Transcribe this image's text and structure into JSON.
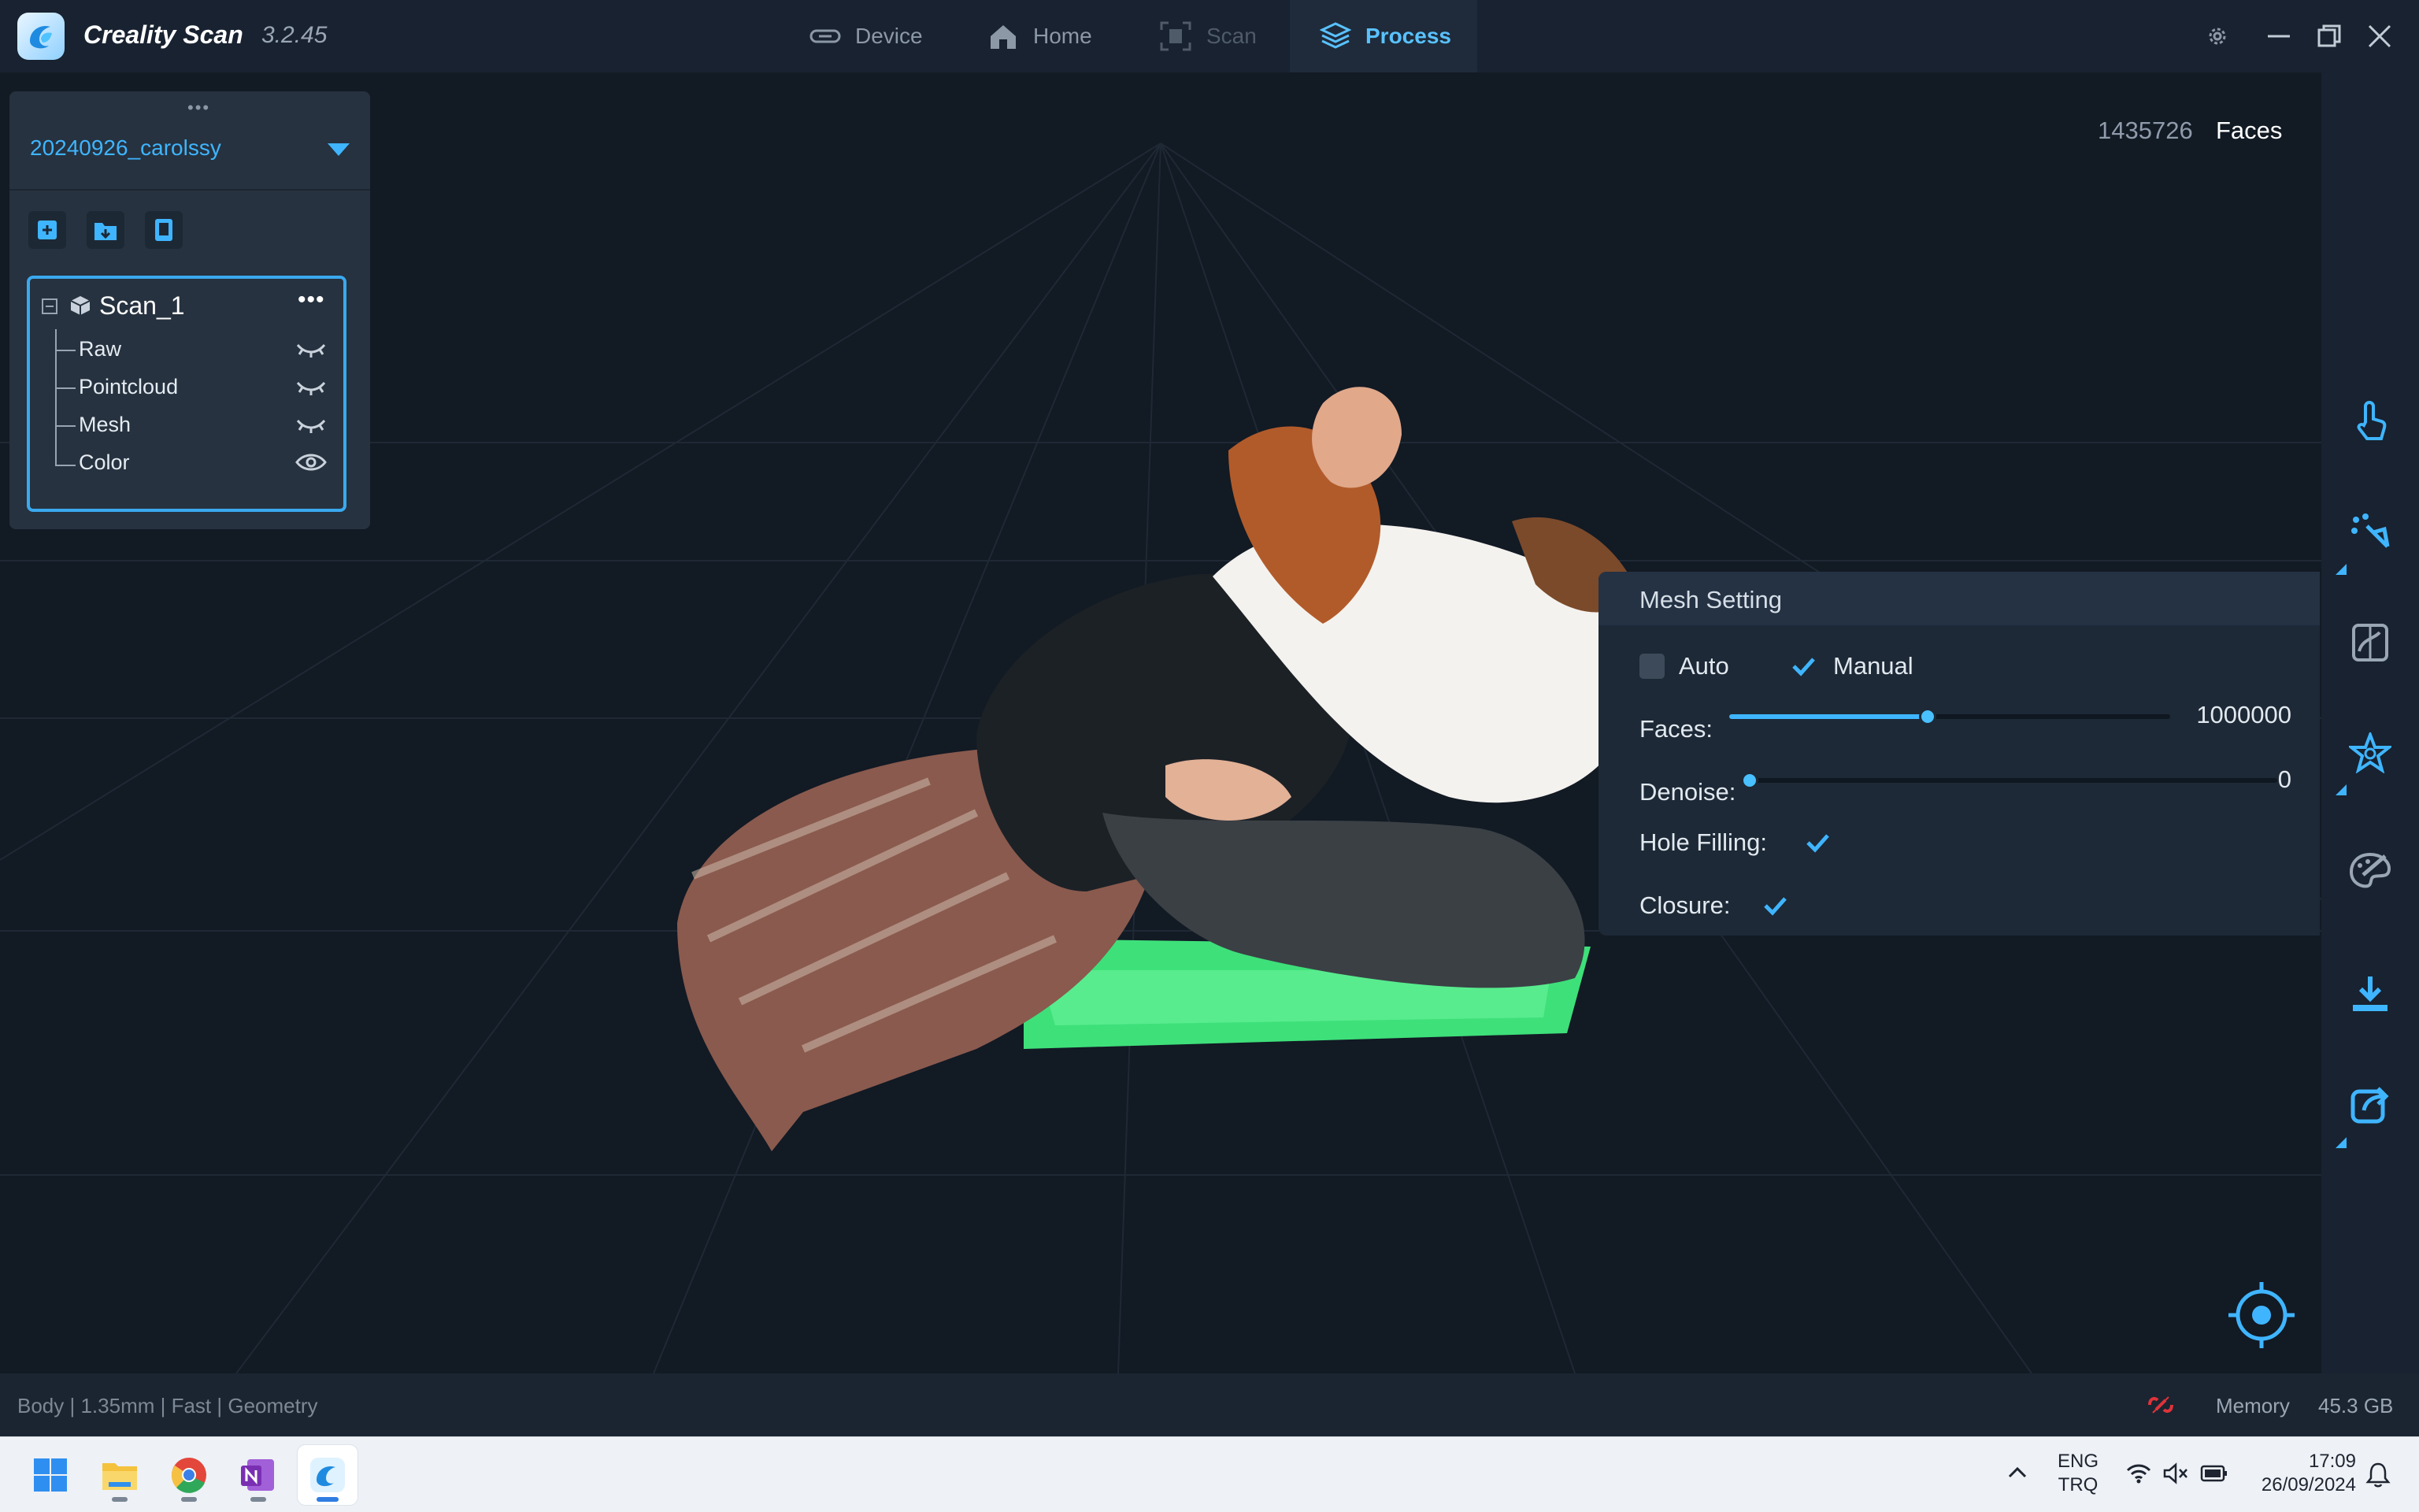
{
  "app": {
    "name": "Creality Scan",
    "version": "3.2.45"
  },
  "tabs": [
    {
      "label": "Device",
      "icon": "device-icon",
      "state": "normal"
    },
    {
      "label": "Home",
      "icon": "home-icon",
      "state": "normal"
    },
    {
      "label": "Scan",
      "icon": "scan-icon",
      "state": "disabled"
    },
    {
      "label": "Process",
      "icon": "layers-icon",
      "state": "active"
    }
  ],
  "window_controls": [
    "settings-icon",
    "minimize-icon",
    "restore-icon",
    "close-icon"
  ],
  "project_panel": {
    "project_name": "20240926_carolssy",
    "drag_handle": "•••",
    "toolbar_icons": [
      "import-model-icon",
      "open-folder-icon",
      "export-project-icon"
    ],
    "tree": {
      "title": "Scan_1",
      "expand_glyph": "⊟",
      "more": "•••",
      "items": [
        {
          "label": "Raw",
          "visible": false
        },
        {
          "label": "Pointcloud",
          "visible": false
        },
        {
          "label": "Mesh",
          "visible": false
        },
        {
          "label": "Color",
          "visible": true
        }
      ]
    }
  },
  "viewport": {
    "faces_count": "1435726",
    "faces_label": "Faces"
  },
  "mesh_setting": {
    "title": "Mesh Setting",
    "auto_label": "Auto",
    "auto_checked": false,
    "manual_label": "Manual",
    "manual_checked": true,
    "faces_label": "Faces:",
    "faces_value": "1000000",
    "faces_slider_fraction": 0.45,
    "denoise_label": "Denoise:",
    "denoise_value": "0",
    "denoise_slider_fraction": 0.0,
    "hole_filling_label": "Hole Filling:",
    "hole_filling_checked": true,
    "closure_label": "Closure:",
    "closure_checked": true
  },
  "right_rail": [
    "touch-select-icon",
    "point-edit-icon",
    "align-icon",
    "mesh-icon",
    "texture-icon",
    "download-icon",
    "share-icon"
  ],
  "status": {
    "left": "Body | 1.35mm | Fast | Geometry",
    "memory_label": "Memory",
    "memory_value": "45.3 GB"
  },
  "taskbar": {
    "apps": [
      "windows-start-icon",
      "file-explorer-icon",
      "chrome-icon",
      "onenote-icon",
      "creality-scan-icon"
    ],
    "lang_top": "ENG",
    "lang_bottom": "TRQ",
    "time": "17:09",
    "date": "26/09/2024"
  },
  "colors": {
    "accent": "#3fb5ff",
    "background": "#131b25",
    "panel": "#26323f",
    "annotation": "#c52be6"
  }
}
